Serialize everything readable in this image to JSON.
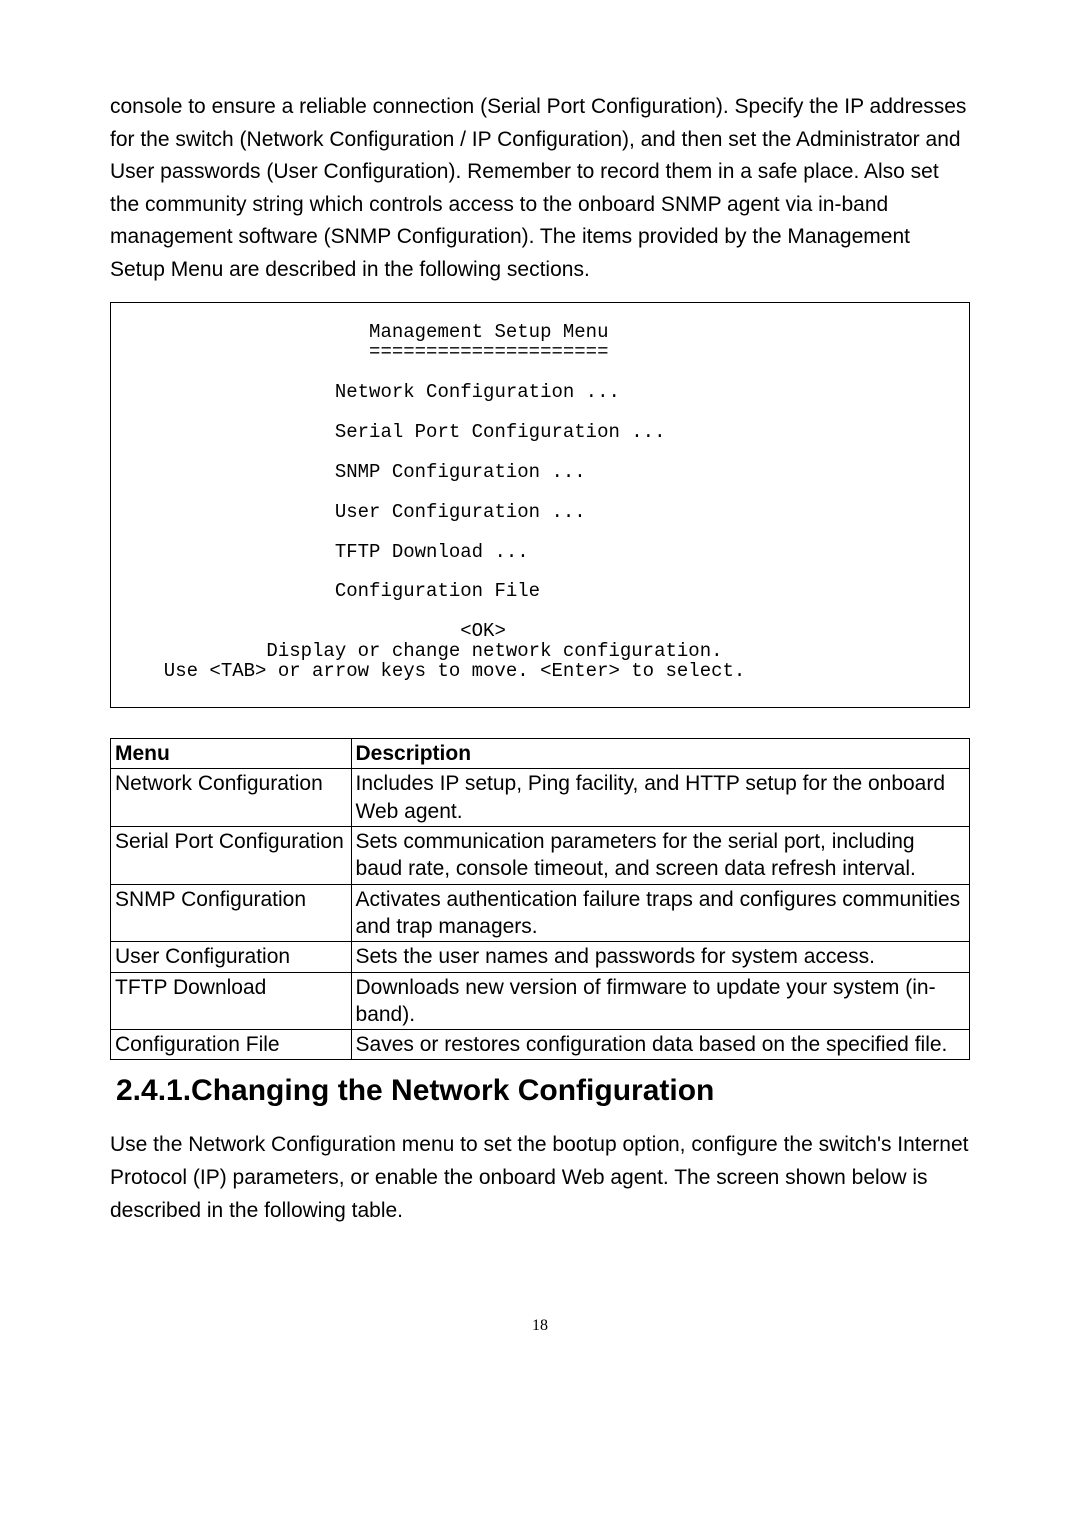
{
  "intro": "console to ensure a reliable connection (Serial Port Configuration). Specify the IP addresses for the switch (Network Configuration / IP Configuration), and then set the Administrator and User passwords (User Configuration). Remember to record them in a safe place. Also set the community string which controls access to the onboard SNMP agent via in-band management software (SNMP Configuration). The items provided by the Management Setup Menu are described in the following sections.",
  "terminal": {
    "title": "                    Management Setup Menu",
    "divider": "                    =====================",
    "items": [
      "                 Network Configuration ...",
      "                 Serial Port Configuration ...",
      "                 SNMP Configuration ...",
      "                 User Configuration ...",
      "                 TFTP Download ...",
      "                 Configuration File"
    ],
    "ok": "                            <OK>",
    "hint1": "           Display or change network configuration.",
    "hint2": "  Use <TAB> or arrow keys to move. <Enter> to select."
  },
  "table": {
    "header": {
      "c0": "Menu",
      "c1": "Description"
    },
    "rows": [
      {
        "c0": "Network Configuration",
        "c1": "Includes IP setup, Ping facility, and HTTP setup for the onboard Web agent."
      },
      {
        "c0": "Serial Port Configuration",
        "c1": "Sets communication parameters for the serial port, including baud rate, console timeout, and screen data refresh interval."
      },
      {
        "c0": "SNMP Configuration",
        "c1": "Activates authentication failure traps and configures communities and trap managers."
      },
      {
        "c0": "User Configuration",
        "c1": "Sets the user names and passwords for system access."
      },
      {
        "c0": "TFTP Download",
        "c1": "Downloads new version of firmware to update your system (in-band)."
      },
      {
        "c0": "Configuration File",
        "c1": "Saves or restores configuration data based on the specified file."
      }
    ]
  },
  "heading": "2.4.1.Changing the Network Configuration",
  "outro": "Use the Network Configuration menu to set the bootup option, configure the switch's Internet Protocol (IP) parameters, or enable the onboard Web agent. The screen shown below is described in the following table.",
  "pagenum": "18"
}
